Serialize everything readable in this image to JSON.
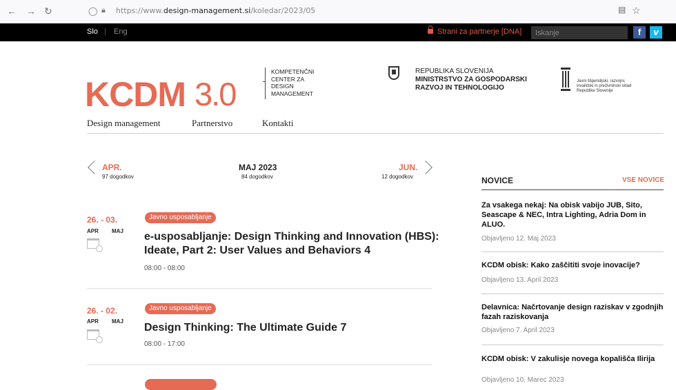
{
  "browser": {
    "url_prefix": "https://www.",
    "url_domain": "design-management.si",
    "url_path": "/koledar/2023/05"
  },
  "topbar": {
    "lang_slo": "Slo",
    "lang_sep": "|",
    "lang_eng": "Eng",
    "partner_link": "Strani za partnerje [DNA]",
    "search_placeholder": "Iskanje",
    "facebook_label": "f",
    "vimeo_label": "v"
  },
  "header": {
    "logo_main": "KCDM",
    "logo_version": "3.0",
    "logo_sub": [
      "KOMPETENČNI",
      "CENTER ZA",
      "DESIGN",
      "MANAGEMENT"
    ],
    "gov_line1": "REPUBLIKA SLOVENIJA",
    "gov_line2": "MINISTRSTVO ZA GOSPODARSKI",
    "gov_line3": "RAZVOJ IN TEHNOLOGIJO",
    "fund_text": "Javni štipendijski, razvojni, invalidski in preživninski sklad Republike Slovenije"
  },
  "nav": {
    "items": [
      "Design management",
      "Partnerstvo",
      "Kontakti"
    ]
  },
  "calendar": {
    "prev": {
      "label": "APR.",
      "count": "97 dogodkov"
    },
    "current": {
      "label": "MAJ 2023",
      "count": "84 dogodkov"
    },
    "next": {
      "label": "JUN.",
      "count": "12 dogodkov"
    }
  },
  "events": [
    {
      "date": "26. - 03.",
      "month_start": "APR",
      "month_end": "MAJ",
      "tag": "Javno usposabljanje",
      "title": "e-usposabljanje: Design Thinking and Innovation (HBS): Ideate, Part 2: User Values and Behaviors 4",
      "time": "08:00 - 08:00"
    },
    {
      "date": "26. - 02.",
      "month_start": "APR",
      "month_end": "MAJ",
      "tag": "Javno usposabljanje",
      "title": "Design Thinking: The Ultimate Guide 7",
      "time": "08:00 - 17:00"
    }
  ],
  "news": {
    "heading": "NOVICE",
    "all_link": "VSE NOVICE",
    "items": [
      {
        "title": "Za vsakega nekaj: Na obisk vabijo JUB, Sito, Seascape & NEC, Intra Lighting, Adria Dom in ALUO.",
        "date": "Objavljeno 12. Maj 2023"
      },
      {
        "title": "KCDM obisk: Kako zaščititi svoje inovacije?",
        "date": "Objavljeno 13. April 2023"
      },
      {
        "title": "Delavnica: Načrtovanje design raziskav v zgodnjih fazah raziskovanja",
        "date": "Objavljeno 7. April 2023"
      },
      {
        "title": "KCDM obisk: V zakulisje novega kopališča Ilirija",
        "date": "Objavljeno 10. Marec 2023"
      }
    ]
  },
  "colors": {
    "accent": "#e56b55",
    "topbar": "#000000"
  }
}
